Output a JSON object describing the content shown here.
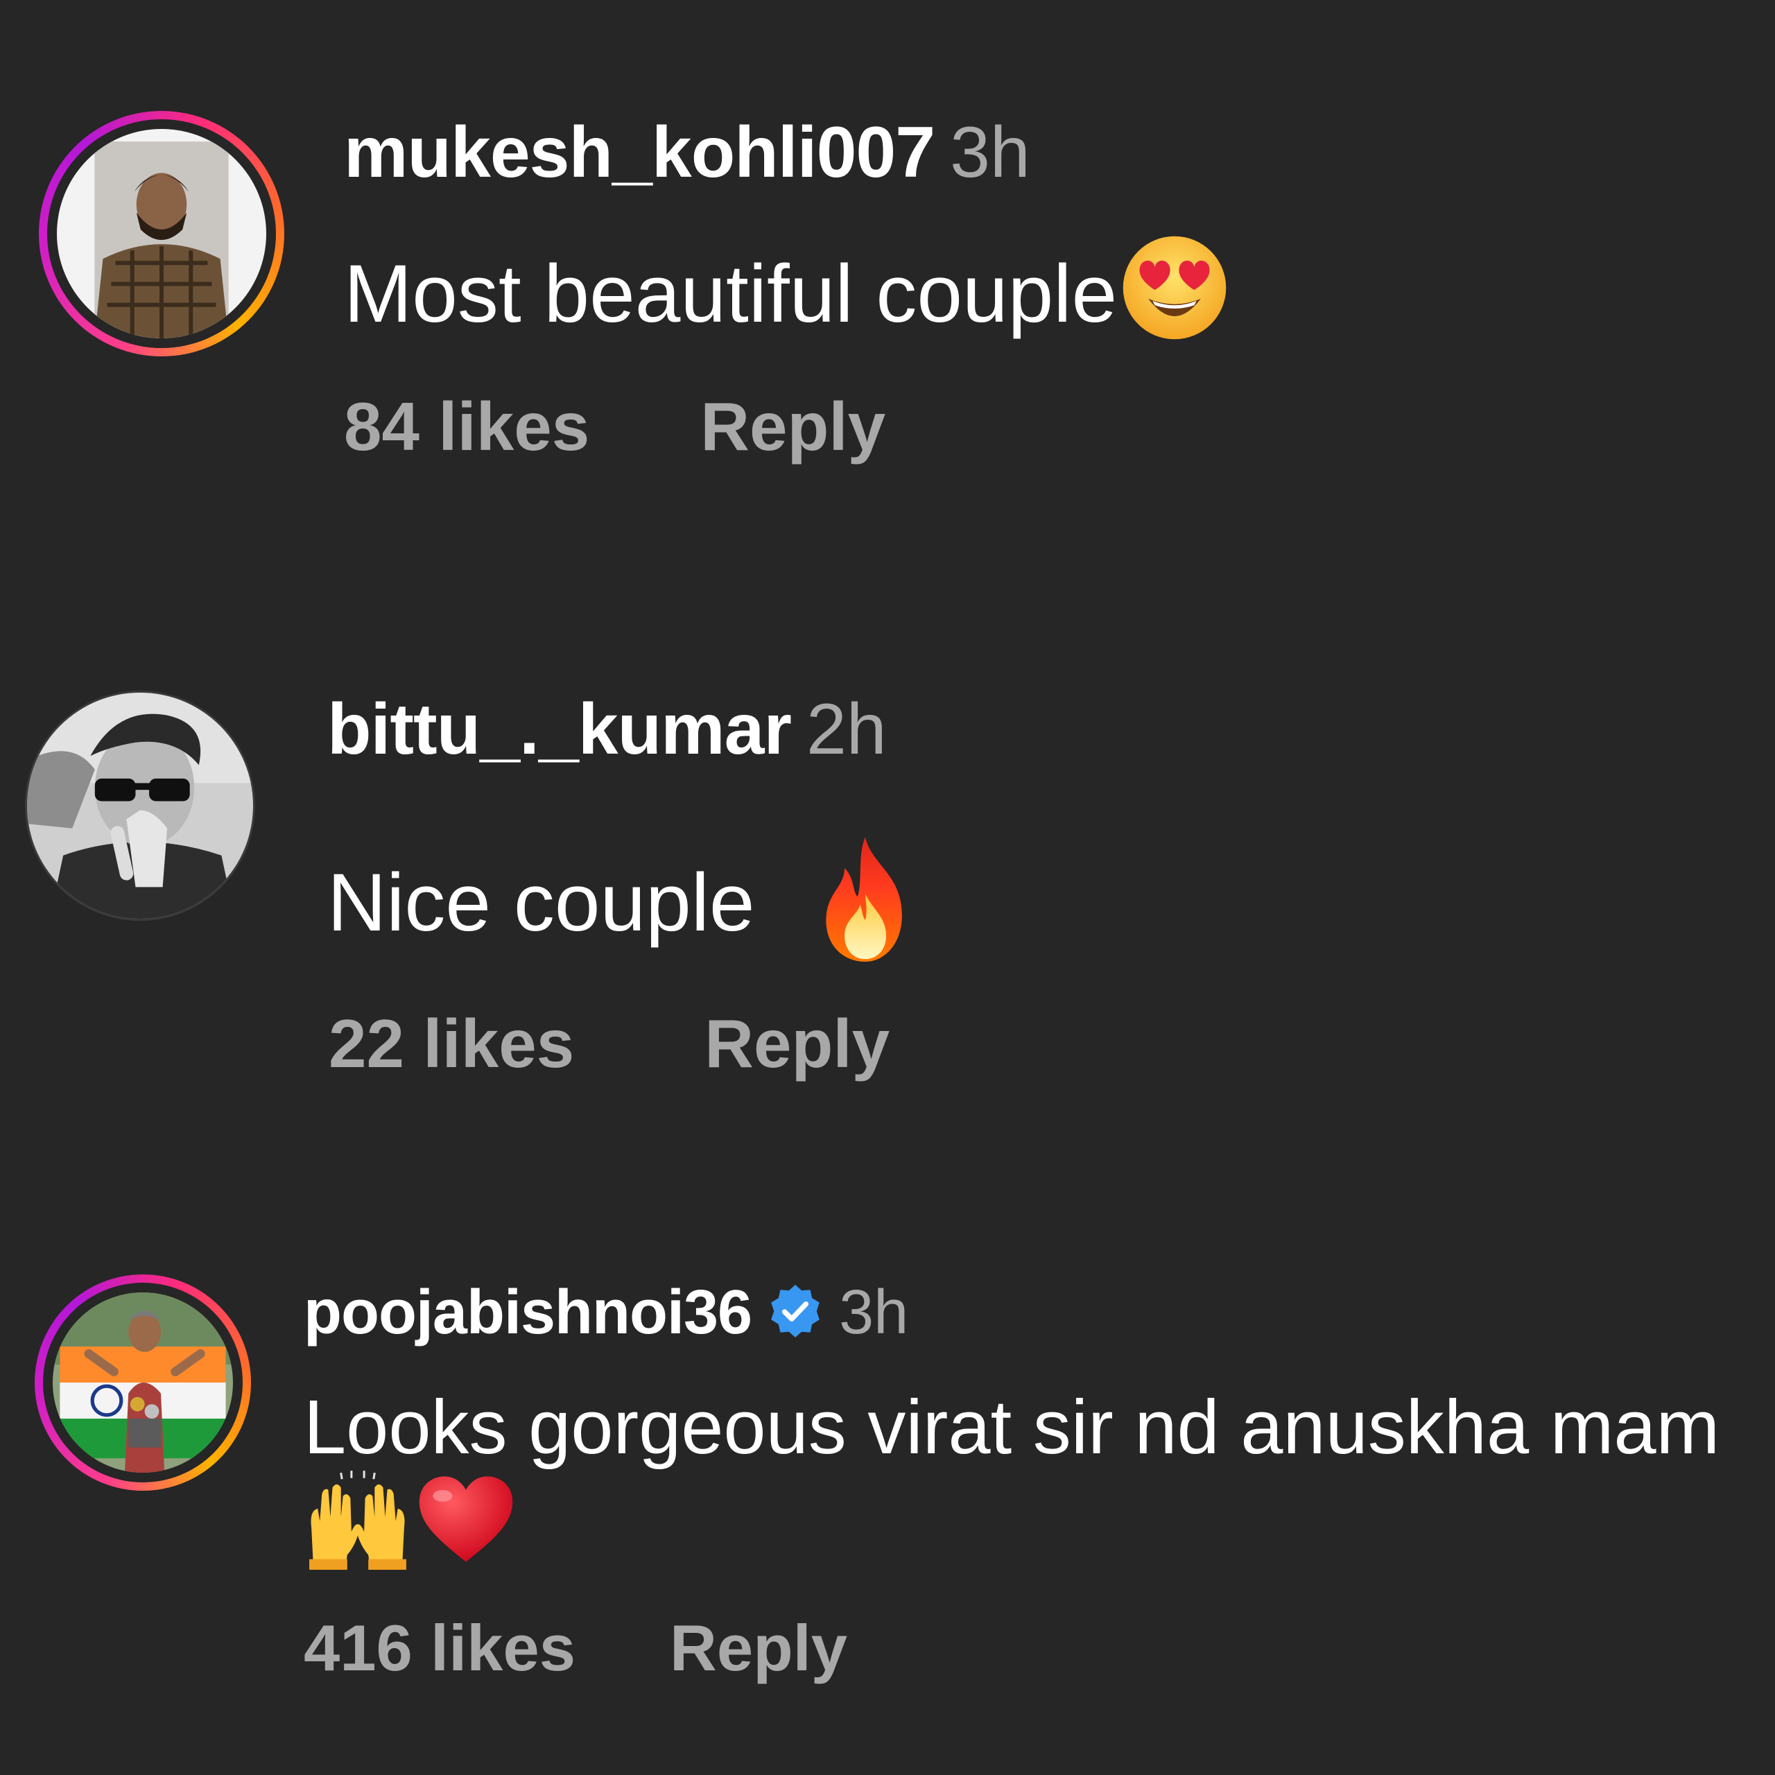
{
  "comments": [
    {
      "username": "mukesh_kohli007",
      "time": "3h",
      "text": "Most beautiful couple",
      "emoji": [
        "heart-eyes-emoji"
      ],
      "likes": "84 likes",
      "reply": "Reply",
      "has_story_ring": true,
      "verified": false
    },
    {
      "username": "bittu_._kumar",
      "time": "2h",
      "text": "Nice couple ",
      "emoji": [
        "fire-emoji"
      ],
      "likes": "22 likes",
      "reply": "Reply",
      "has_story_ring": false,
      "verified": false
    },
    {
      "username": "poojabishnoi36",
      "time": "3h",
      "text": "Looks gorgeous virat sir nd anuskha mam",
      "emoji": [
        "raising-hands-emoji",
        "red-heart-emoji"
      ],
      "likes": "416 likes",
      "reply": "Reply",
      "has_story_ring": true,
      "verified": true
    }
  ],
  "colors": {
    "background": "#262626",
    "text_primary": "#ffffff",
    "text_secondary": "#a8a8a8",
    "verified_badge": "#0095f6"
  }
}
